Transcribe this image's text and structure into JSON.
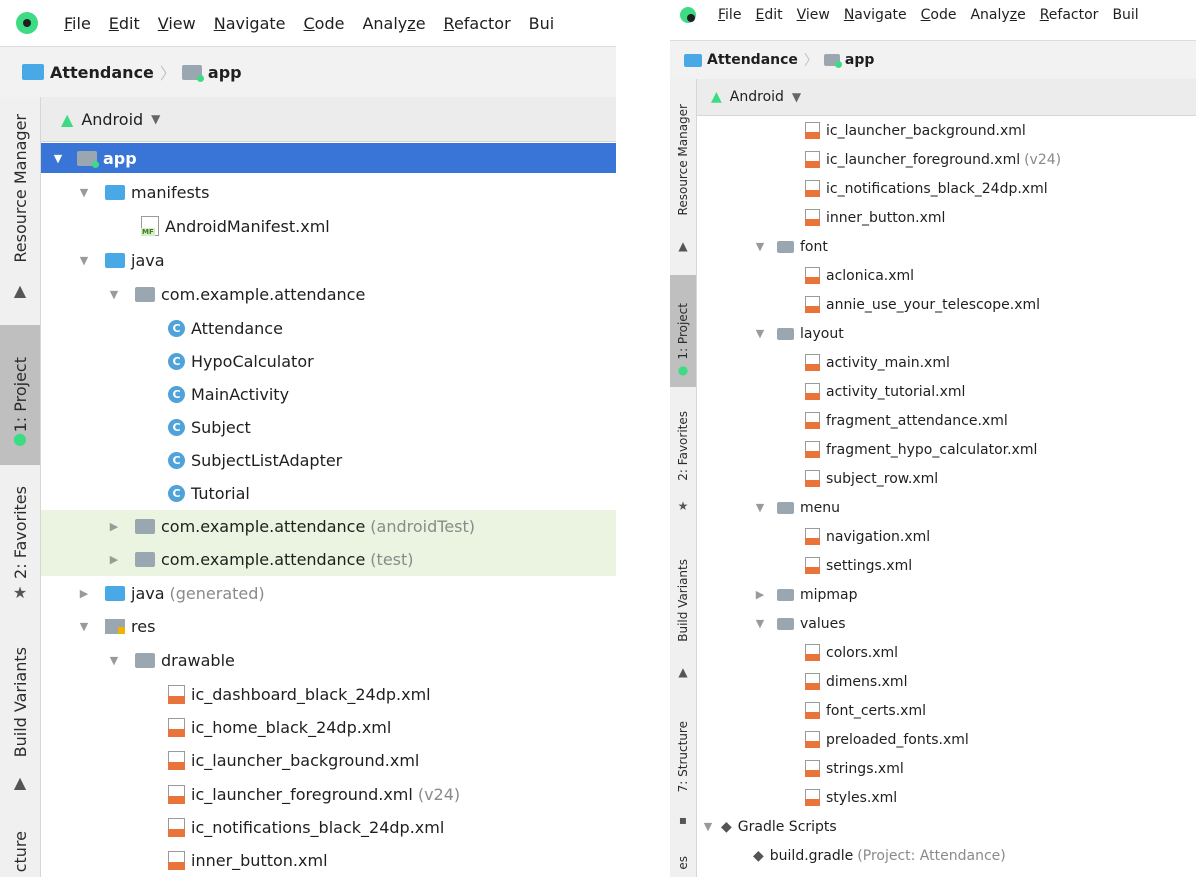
{
  "menu": {
    "file": "File",
    "edit": "Edit",
    "view": "View",
    "navigate": "Navigate",
    "code": "Code",
    "analyze": "Analyze",
    "refactor": "Refactor",
    "build_left": "Bui",
    "build_right": "Buil"
  },
  "breadcrumb": {
    "project": "Attendance",
    "module": "app"
  },
  "tool_window": {
    "view_selector": "Android"
  },
  "side_tabs": {
    "resource_manager": "Resource Manager",
    "project": "1: Project",
    "favorites": "2: Favorites",
    "build_variants": "Build Variants",
    "structure_left": "cture",
    "structure_right": "7: Structure",
    "cut_right": "es"
  },
  "left_tree": [
    {
      "label": "app",
      "note": ""
    },
    {
      "label": "manifests",
      "note": ""
    },
    {
      "label": "AndroidManifest.xml",
      "note": ""
    },
    {
      "label": "java",
      "note": ""
    },
    {
      "label": "com.example.attendance",
      "note": ""
    },
    {
      "label": "Attendance",
      "note": ""
    },
    {
      "label": "HypoCalculator",
      "note": ""
    },
    {
      "label": "MainActivity",
      "note": ""
    },
    {
      "label": "Subject",
      "note": ""
    },
    {
      "label": "SubjectListAdapter",
      "note": ""
    },
    {
      "label": "Tutorial",
      "note": ""
    },
    {
      "label": "com.example.attendance",
      "note": "(androidTest)"
    },
    {
      "label": "com.example.attendance",
      "note": "(test)"
    },
    {
      "label": "java",
      "note": "(generated)"
    },
    {
      "label": "res",
      "note": ""
    },
    {
      "label": "drawable",
      "note": ""
    },
    {
      "label": "ic_dashboard_black_24dp.xml",
      "note": ""
    },
    {
      "label": "ic_home_black_24dp.xml",
      "note": ""
    },
    {
      "label": "ic_launcher_background.xml",
      "note": ""
    },
    {
      "label": "ic_launcher_foreground.xml",
      "note": "(v24)"
    },
    {
      "label": "ic_notifications_black_24dp.xml",
      "note": ""
    },
    {
      "label": "inner_button.xml",
      "note": ""
    }
  ],
  "right_tree": [
    {
      "label": "ic_launcher_background.xml",
      "note": ""
    },
    {
      "label": "ic_launcher_foreground.xml",
      "note": "(v24)"
    },
    {
      "label": "ic_notifications_black_24dp.xml",
      "note": ""
    },
    {
      "label": "inner_button.xml",
      "note": ""
    },
    {
      "label": "font",
      "note": ""
    },
    {
      "label": "aclonica.xml",
      "note": ""
    },
    {
      "label": "annie_use_your_telescope.xml",
      "note": ""
    },
    {
      "label": "layout",
      "note": ""
    },
    {
      "label": "activity_main.xml",
      "note": ""
    },
    {
      "label": "activity_tutorial.xml",
      "note": ""
    },
    {
      "label": "fragment_attendance.xml",
      "note": ""
    },
    {
      "label": "fragment_hypo_calculator.xml",
      "note": ""
    },
    {
      "label": "subject_row.xml",
      "note": ""
    },
    {
      "label": "menu",
      "note": ""
    },
    {
      "label": "navigation.xml",
      "note": ""
    },
    {
      "label": "settings.xml",
      "note": ""
    },
    {
      "label": "mipmap",
      "note": ""
    },
    {
      "label": "values",
      "note": ""
    },
    {
      "label": "colors.xml",
      "note": ""
    },
    {
      "label": "dimens.xml",
      "note": ""
    },
    {
      "label": "font_certs.xml",
      "note": ""
    },
    {
      "label": "preloaded_fonts.xml",
      "note": ""
    },
    {
      "label": "strings.xml",
      "note": ""
    },
    {
      "label": "styles.xml",
      "note": ""
    },
    {
      "label": "Gradle Scripts",
      "note": ""
    },
    {
      "label": "build.gradle",
      "note": "(Project: Attendance)"
    }
  ],
  "colors": {
    "selection": "#3875d7",
    "test_source_bg": "#eaf4e0",
    "android_green": "#3ddc84",
    "class_icon": "#4fa3d9",
    "xml_icon": "#e8743b"
  }
}
